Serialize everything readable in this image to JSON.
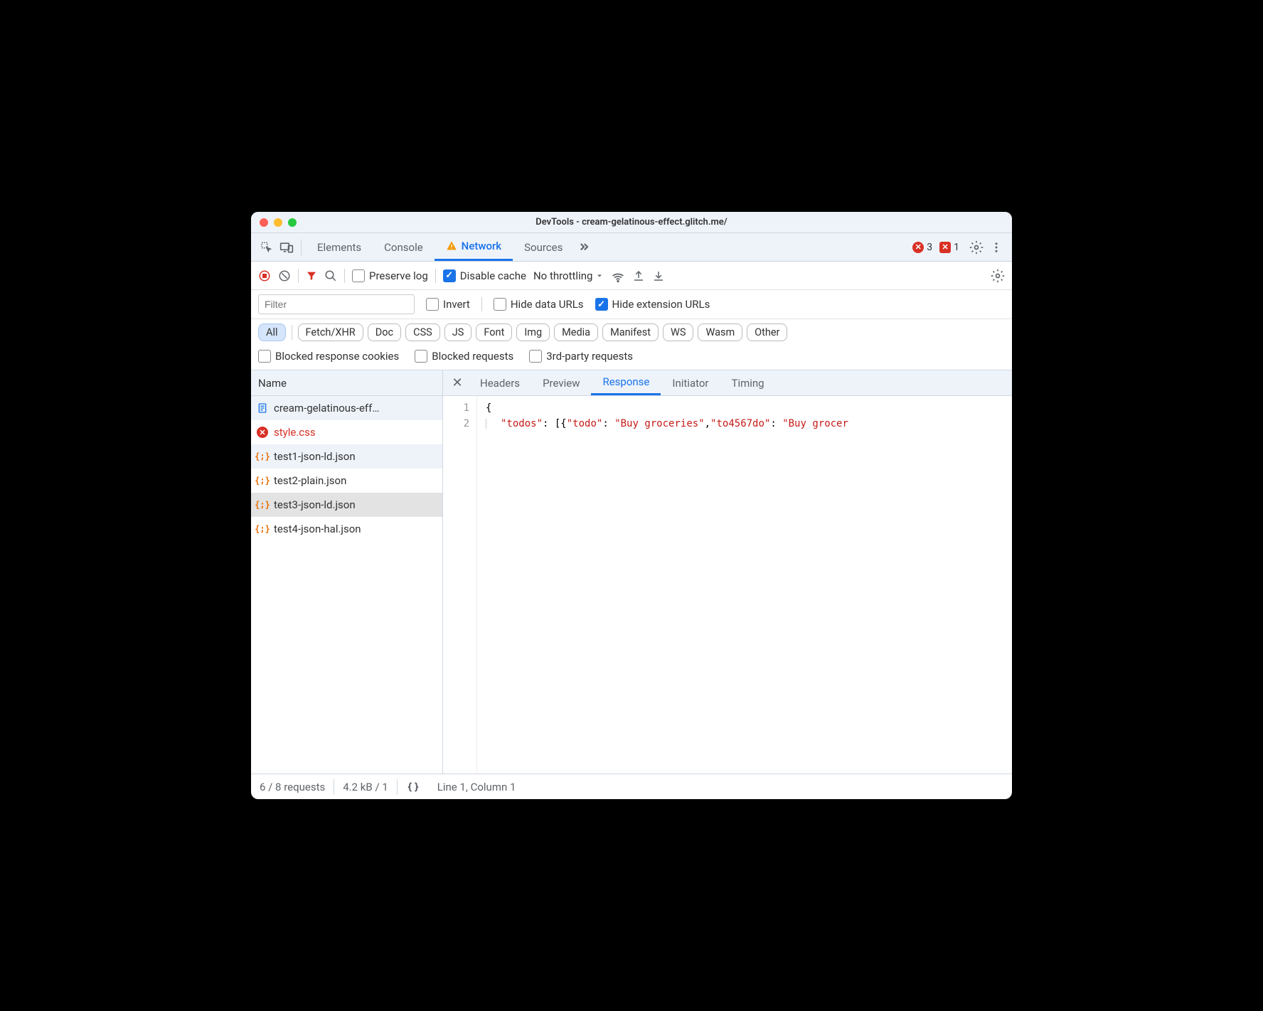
{
  "window": {
    "title": "DevTools - cream-gelatinous-effect.glitch.me/"
  },
  "main_tabs": {
    "items": [
      "Elements",
      "Console",
      "Network",
      "Sources"
    ],
    "active": "Network",
    "errors_count": "3",
    "issues_count": "1"
  },
  "toolbar": {
    "preserve_log_label": "Preserve log",
    "preserve_log_checked": false,
    "disable_cache_label": "Disable cache",
    "disable_cache_checked": true,
    "throttling": "No throttling"
  },
  "filters": {
    "placeholder": "Filter",
    "invert_label": "Invert",
    "invert_checked": false,
    "hide_data_urls_label": "Hide data URLs",
    "hide_data_urls_checked": false,
    "hide_ext_urls_label": "Hide extension URLs",
    "hide_ext_urls_checked": true,
    "types": [
      "All",
      "Fetch/XHR",
      "Doc",
      "CSS",
      "JS",
      "Font",
      "Img",
      "Media",
      "Manifest",
      "WS",
      "Wasm",
      "Other"
    ],
    "active_type": "All",
    "blocked_cookies_label": "Blocked response cookies",
    "blocked_requests_label": "Blocked requests",
    "third_party_label": "3rd-party requests"
  },
  "request_list": {
    "header": "Name",
    "rows": [
      {
        "name": "cream-gelatinous-eff…",
        "icon": "doc",
        "error": false
      },
      {
        "name": "style.css",
        "icon": "error",
        "error": true
      },
      {
        "name": "test1-json-ld.json",
        "icon": "json",
        "error": false
      },
      {
        "name": "test2-plain.json",
        "icon": "json",
        "error": false
      },
      {
        "name": "test3-json-ld.json",
        "icon": "json",
        "error": false,
        "selected": true
      },
      {
        "name": "test4-json-hal.json",
        "icon": "json",
        "error": false
      }
    ]
  },
  "detail": {
    "tabs": [
      "Headers",
      "Preview",
      "Response",
      "Initiator",
      "Timing"
    ],
    "active": "Response",
    "response_lines": [
      "1",
      "2"
    ],
    "response_code": {
      "l1": "{",
      "l2_k1": "\"todos\"",
      "l2_p1": ": [{",
      "l2_k2": "\"todo\"",
      "l2_p2": ": ",
      "l2_s1": "\"Buy groceries\"",
      "l2_p3": ",",
      "l2_k3": "\"to4567do\"",
      "l2_p4": ": ",
      "l2_s2": "\"Buy grocer"
    }
  },
  "status": {
    "requests": "6 / 8 requests",
    "transferred": "4.2 kB / 1",
    "cursor": "Line 1, Column 1"
  }
}
